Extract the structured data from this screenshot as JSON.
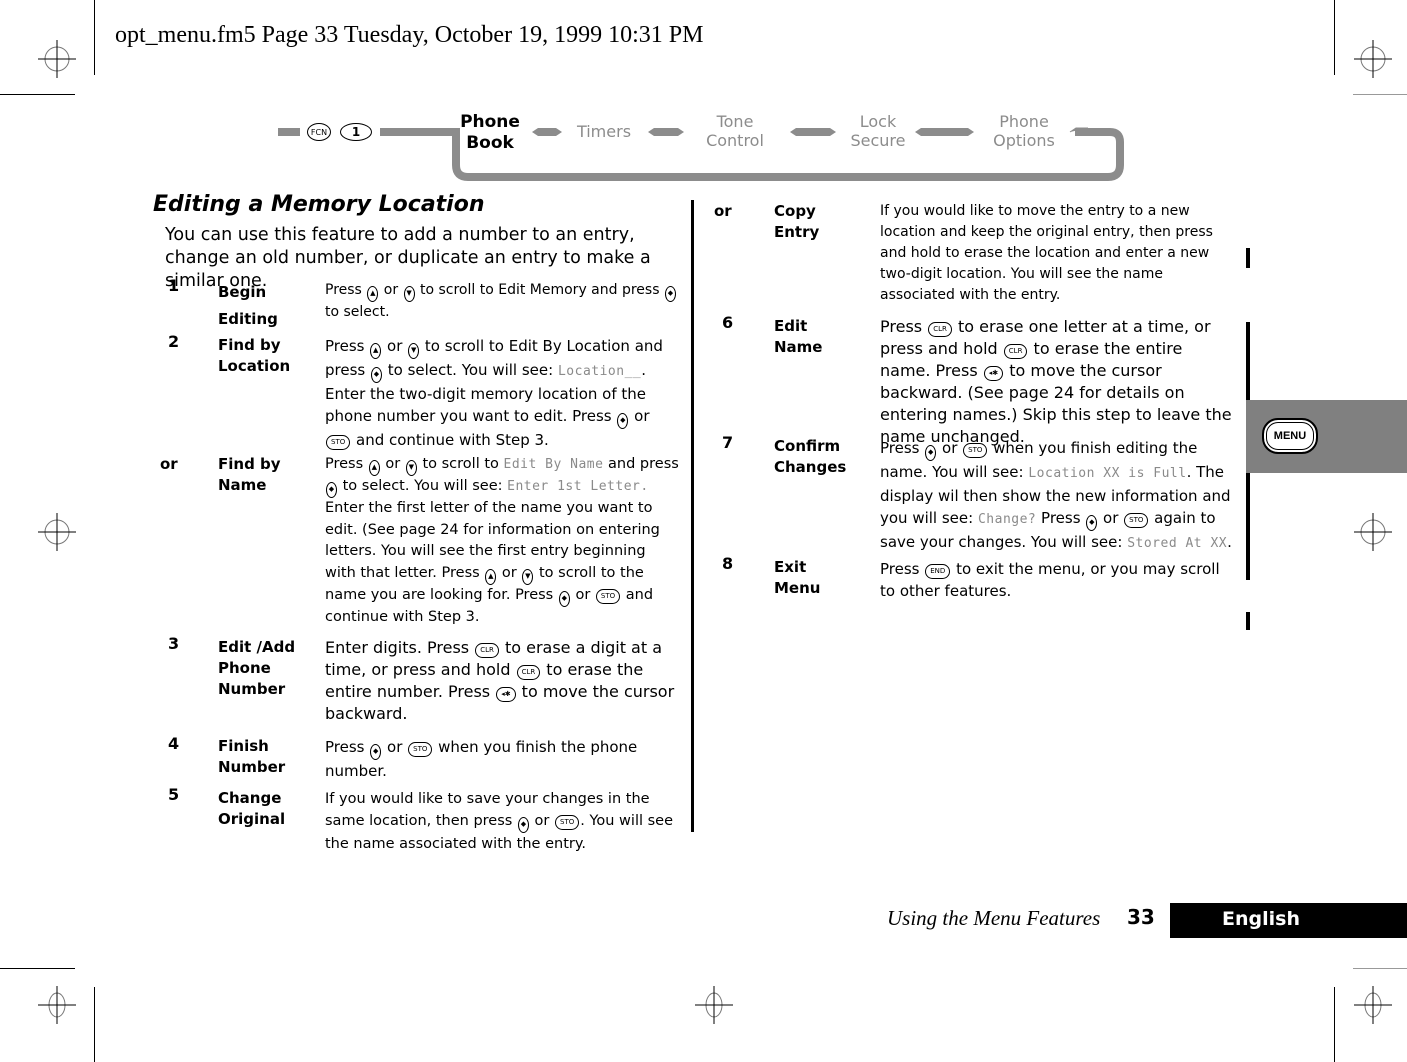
{
  "slug": "opt_menu.fm5  Page 33  Tuesday, October 19, 1999  10:31 PM",
  "nav_diagram": {
    "keys": [
      "FCN",
      "1"
    ],
    "items": [
      {
        "label_line1": "Phone",
        "label_line2": "Book",
        "active": true
      },
      {
        "label_line1": "Timers",
        "label_line2": "",
        "active": false
      },
      {
        "label_line1": "Tone",
        "label_line2": "Control",
        "active": false
      },
      {
        "label_line1": "Lock",
        "label_line2": "Secure",
        "active": false
      },
      {
        "label_line1": "Phone",
        "label_line2": "Options",
        "active": false
      }
    ]
  },
  "section": {
    "title": "Editing a Memory Location",
    "intro": "You can use this feature to add a number to an entry, change an old number, or duplicate an entry to make a similar one."
  },
  "buttons": {
    "sto": "STO",
    "clr": "CLR",
    "end": "END",
    "back": "◂✱",
    "up": "▲",
    "down": "▼",
    "select": "◆"
  },
  "steps": [
    {
      "num": "1",
      "label": [
        "Begin",
        "Editing"
      ],
      "parts": [
        "Press ",
        "{up}",
        " or ",
        "{down}",
        " to scroll to Edit Memory and press ",
        "{select}",
        " to select."
      ]
    },
    {
      "num": "2",
      "label": [
        "Find by",
        "Location"
      ],
      "parts": [
        "Press ",
        "{up}",
        " or ",
        "{down}",
        " to scroll to Edit By Location and press ",
        "{select}",
        " to select. You will see: ",
        "[Location__]",
        ". Enter the two-digit memory location of the phone number you want to edit. Press ",
        "{select}",
        " or ",
        "{sto}",
        " and continue with Step 3."
      ]
    },
    {
      "num": "or",
      "label": [
        "Find by",
        "Name"
      ],
      "parts": [
        "Press ",
        "{up}",
        " or ",
        "{down}",
        " to scroll to ",
        "[Edit By Name]",
        " and press ",
        "{select}",
        " to select. You will see: ",
        "[Enter 1st Letter.]",
        " Enter the first letter of the name you want to edit. (See page 24 for information on entering letters. You will see the first entry beginning with that letter. Press ",
        "{up}",
        " or ",
        "{down}",
        " to scroll to the name you are looking for. Press ",
        "{select}",
        " or ",
        "{sto}",
        " and continue with Step 3."
      ]
    },
    {
      "num": "3",
      "label": [
        "Edit /Add",
        "Phone",
        "Number"
      ],
      "parts": [
        "Enter digits. Press ",
        "{clr}",
        " to erase a digit at a time, or press and hold ",
        "{clr}",
        " to erase the entire number. Press ",
        "{back}",
        " to move the cursor backward."
      ]
    },
    {
      "num": "4",
      "label": [
        "Finish",
        "Number"
      ],
      "parts": [
        "Press ",
        "{select}",
        " or ",
        "{sto}",
        " when you finish the phone number."
      ]
    },
    {
      "num": "5",
      "label": [
        "Change",
        "Original"
      ],
      "parts": [
        "If you would like to save your changes in the same location, then press ",
        "{select}",
        " or ",
        "{sto}",
        ". You will see the name associated with the entry."
      ]
    },
    {
      "num": "or",
      "label": [
        "Copy",
        "Entry"
      ],
      "parts": [
        "If you would like to move the entry to a new location and keep the original entry, then press and hold    to erase the location and enter a new two-digit location. You will see the name associated with the entry."
      ]
    },
    {
      "num": "6",
      "label": [
        "Edit",
        "Name"
      ],
      "parts": [
        "Press ",
        "{clr}",
        " to erase one letter at a time, or press and hold ",
        "{clr}",
        " to erase the entire name. Press ",
        "{back}",
        " to move the cursor backward. (See page 24 for details on entering names.) Skip this step to leave the name unchanged."
      ]
    },
    {
      "num": "7",
      "label": [
        "Confirm",
        "Changes"
      ],
      "parts": [
        "Press ",
        "{select}",
        " or ",
        "{sto}",
        " when you finish editing the name. You will see: ",
        "[Location XX is Full]",
        ". The display wil then show the new information and you will see: ",
        "[Change?]",
        " Press ",
        "{select}",
        " or ",
        "{sto}",
        " again to save your changes. You will see: ",
        "[Stored At XX]",
        "."
      ]
    },
    {
      "num": "8",
      "label": [
        "Exit",
        "Menu"
      ],
      "parts": [
        "Press ",
        "{end}",
        " to exit the menu, or you may scroll to other features."
      ]
    }
  ],
  "side_tab": {
    "label": "MENU"
  },
  "footer": {
    "chapter": "Using the Menu Features",
    "page": "33",
    "language": "English"
  },
  "colors": {
    "nav_gray": "#8c8c8c",
    "tab_band": "#808080",
    "lcd_text": "#8a8a8a",
    "language_bg": "#000000"
  }
}
